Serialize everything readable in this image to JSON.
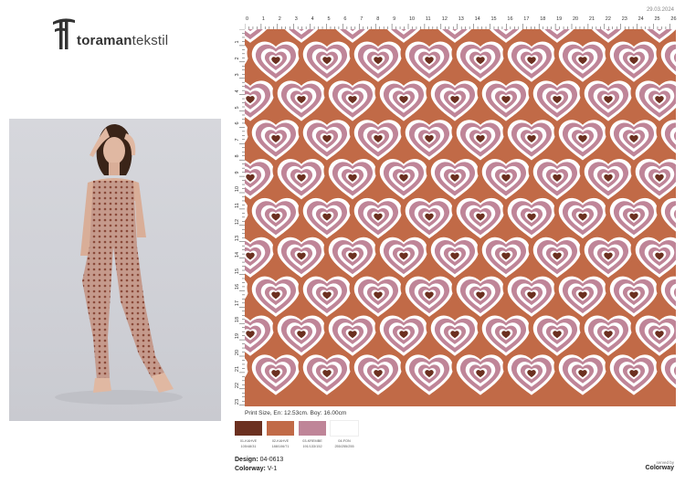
{
  "date": "29.03.2024",
  "brand": {
    "name_bold": "toraman",
    "name_light": "tekstil"
  },
  "rulers": {
    "top": [
      "0",
      "1",
      "2",
      "3",
      "4",
      "5",
      "6",
      "7",
      "8",
      "9",
      "10",
      "11",
      "12",
      "13",
      "14",
      "15",
      "16",
      "17",
      "18",
      "19",
      "20",
      "21",
      "22",
      "23",
      "24",
      "25",
      "26"
    ],
    "left": [
      "1",
      "2",
      "3",
      "4",
      "5",
      "6",
      "7",
      "8",
      "9",
      "10",
      "11",
      "12",
      "13",
      "14",
      "15",
      "16",
      "17",
      "18",
      "19",
      "20",
      "21",
      "22",
      "23"
    ]
  },
  "print_size": "Print Size, En: 12.53cm. Boy: 16.00cm",
  "colorways": [
    {
      "name": "01-KAHVE",
      "rgb": "105/48/31",
      "color": "#6b3020"
    },
    {
      "name": "02-KAHVE",
      "rgb": "188/106/71",
      "color": "#c16a47"
    },
    {
      "name": "03-KREMBE",
      "rgb": "191/133/152",
      "color": "#bf8598"
    },
    {
      "name": "04-FON",
      "rgb": "255/255/255",
      "color": "#ffffff"
    }
  ],
  "meta": {
    "design_label": "Design:",
    "design_value": "04-0613",
    "colorway_label": "Colorway:",
    "colorway_value": "V-1"
  },
  "served": {
    "line1": "served by",
    "line2": "Colorway"
  }
}
